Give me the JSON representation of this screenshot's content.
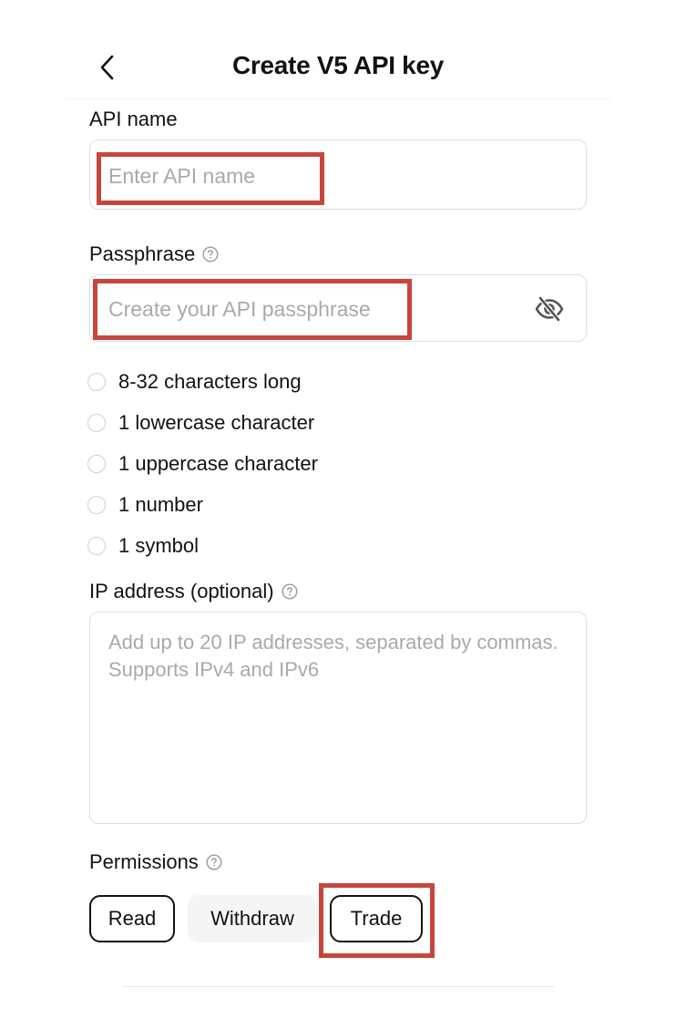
{
  "header": {
    "title": "Create V5 API key",
    "back_icon": "chevron-left-icon"
  },
  "api_name": {
    "label": "API name",
    "placeholder": "Enter API name",
    "value": ""
  },
  "passphrase": {
    "label": "Passphrase",
    "placeholder": "Create your API passphrase",
    "value": "",
    "visibility_icon": "eye-off-icon",
    "help_icon": "question-circle-icon",
    "rules": [
      {
        "label": "8-32 characters long",
        "met": false
      },
      {
        "label": "1 lowercase character",
        "met": false
      },
      {
        "label": "1 uppercase character",
        "met": false
      },
      {
        "label": "1 number",
        "met": false
      },
      {
        "label": "1 symbol",
        "met": false
      }
    ]
  },
  "ip_address": {
    "label": "IP address (optional)",
    "placeholder": "Add up to 20 IP addresses, separated by commas. Supports IPv4 and IPv6",
    "value": "",
    "help_icon": "question-circle-icon"
  },
  "permissions": {
    "label": "Permissions",
    "help_icon": "question-circle-icon",
    "options": [
      {
        "label": "Read",
        "selected": true
      },
      {
        "label": "Withdraw",
        "selected": false
      },
      {
        "label": "Trade",
        "selected": true
      }
    ]
  },
  "colors": {
    "highlight": "#c8453c",
    "text": "#121212",
    "placeholder": "#a9a9a9",
    "border": "#dedede",
    "unselected_bg": "#f5f5f5"
  }
}
